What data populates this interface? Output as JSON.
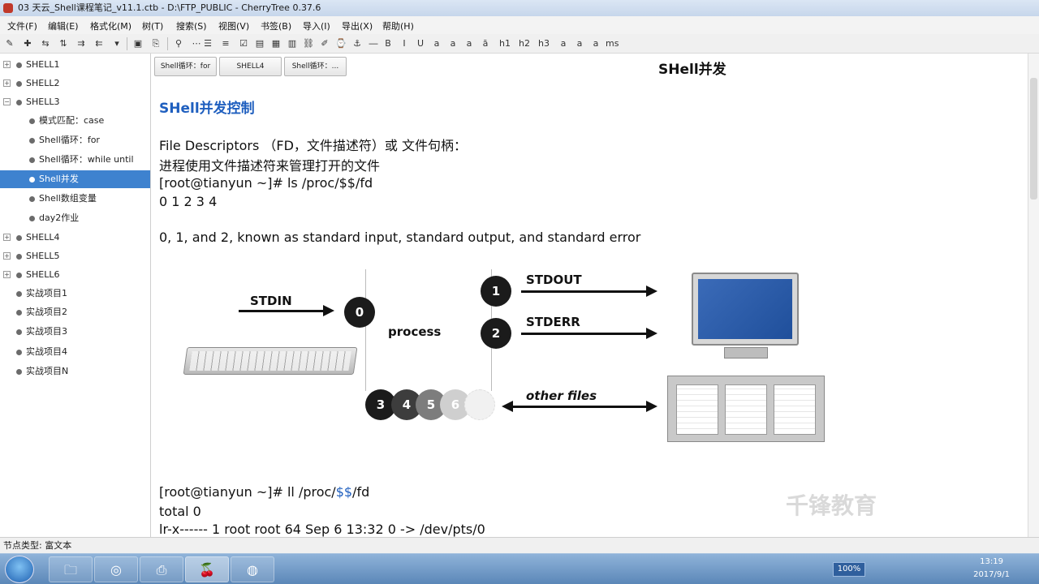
{
  "window": {
    "title": "03 天云_Shell课程笔记_v11.1.ctb - D:\\FTP_PUBLIC - CherryTree 0.37.6"
  },
  "menu": [
    "文件(F)",
    "编辑(E)",
    "格式化(M)",
    "树(T)",
    "搜索(S)",
    "视图(V)",
    "书签(B)",
    "导入(I)",
    "导出(X)",
    "帮助(H)"
  ],
  "toolbar": {
    "buttons": [
      "h1",
      "h2",
      "h3",
      "a",
      "a",
      "a",
      "a",
      "a",
      "ms"
    ]
  },
  "tree": {
    "items": [
      {
        "label": "SHELL1",
        "icon": "plus-icon"
      },
      {
        "label": "SHELL2",
        "icon": "plus-icon"
      },
      {
        "label": "SHELL3",
        "icon": "minus-icon"
      },
      {
        "label": "模式匹配：case"
      },
      {
        "label": "Shell循环：for"
      },
      {
        "label": "Shell循环：while until"
      },
      {
        "label": "Shell并发",
        "selected": true
      },
      {
        "label": "Shell数组变量"
      },
      {
        "label": "day2作业"
      },
      {
        "label": "SHELL4",
        "icon": "plus-icon"
      },
      {
        "label": "SHELL5",
        "icon": "plus-icon"
      },
      {
        "label": "SHELL6",
        "icon": "plus-icon"
      },
      {
        "label": "实战项目1"
      },
      {
        "label": "实战项目2"
      },
      {
        "label": "实战项目3"
      },
      {
        "label": "实战项目4"
      },
      {
        "label": "实战项目N"
      }
    ]
  },
  "tabs": [
    "Shell循环：for",
    "SHELL4",
    "Shell循环：..."
  ],
  "node": {
    "title": "SHell并发"
  },
  "content": {
    "heading": "SHell并发控制",
    "fd_title": "File Descriptors （FD，文件描述符）或 文件句柄：",
    "fd_desc": "进程使用文件描述符来管理打开的文件",
    "cmd1": "[root@tianyun ~]# ls /proc/$$/fd",
    "cmd1_output": "0  1  2  3  4",
    "std_line": "0, 1, and 2, known as standard input, standard output, and standard error",
    "cmd2_prefix": "[root@tianyun ~]# ll /proc/",
    "cmd2_var": "$$",
    "cmd2_suffix": "/fd",
    "total": "total 0",
    "ls_line": "lr-x------ 1 root root 64 Sep  6 13:32 0 -> /dev/pts/0"
  },
  "diagram": {
    "stdin": "STDIN",
    "stdout": "STDOUT",
    "stderr": "STDERR",
    "process": "process",
    "other_files": "other files",
    "fd_circles": [
      "0",
      "1",
      "2",
      "3",
      "4",
      "5",
      "6"
    ]
  },
  "watermark": "千锋教育",
  "statusbar": {
    "text": "节点类型: 富文本"
  },
  "taskbar": {
    "zoom": "100%",
    "time": "13:19",
    "date": "2017/9/1"
  },
  "colors": {
    "accent": "#1f5fbf",
    "selection": "#3e82cf"
  }
}
